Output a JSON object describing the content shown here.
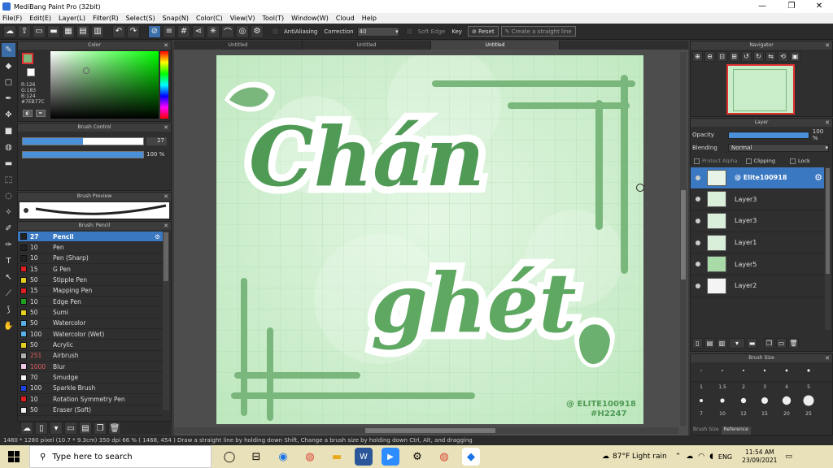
{
  "window": {
    "title": "MediBang Paint Pro (32bit)",
    "minimize": "—",
    "maximize": "❐",
    "close": "✕"
  },
  "menu": [
    "File(F)",
    "Edit(E)",
    "Layer(L)",
    "Filter(R)",
    "Select(S)",
    "Snap(N)",
    "Color(C)",
    "View(V)",
    "Tool(T)",
    "Window(W)",
    "Cloud",
    "Help"
  ],
  "toolbar": {
    "antialiasing": "AntiAliasing",
    "correction_label": "Correction",
    "correction_value": "40",
    "soft_edge": "Soft Edge",
    "key_label": "Key",
    "reset": "Reset",
    "straight_line": "Create a straight line"
  },
  "tabs": [
    "Untitled",
    "Untitled",
    "Untitled"
  ],
  "color_panel": {
    "title": "Color",
    "r": "R:126",
    "g": "G:183",
    "b": "B:124",
    "hex": "#7EB77C",
    "primary_color": "#7EB77C"
  },
  "brush_control": {
    "title": "Brush Control",
    "size": "27",
    "opacity": "100 %",
    "size_fill": 0.5,
    "opacity_fill": 1.0
  },
  "brush_preview": {
    "title": "Brush Preview"
  },
  "brush_list": {
    "title": "Brush: Pencil",
    "items": [
      {
        "size": "27",
        "name": "Pencil",
        "color": "#222222"
      },
      {
        "size": "10",
        "name": "Pen",
        "color": "#222222"
      },
      {
        "size": "10",
        "name": "Pen (Sharp)",
        "color": "#222222"
      },
      {
        "size": "15",
        "name": "G Pen",
        "color": "#e02020"
      },
      {
        "size": "50",
        "name": "Stipple Pen",
        "color": "#e8d020"
      },
      {
        "size": "15",
        "name": "Mapping Pen",
        "color": "#e02020"
      },
      {
        "size": "10",
        "name": "Edge Pen",
        "color": "#20a020"
      },
      {
        "size": "50",
        "name": "Sumi",
        "color": "#e8d020"
      },
      {
        "size": "50",
        "name": "Watercolor",
        "color": "#5ab0e8"
      },
      {
        "size": "100",
        "name": "Watercolor (Wet)",
        "color": "#5ab0e8"
      },
      {
        "size": "50",
        "name": "Acrylic",
        "color": "#e8d020"
      },
      {
        "size": "251",
        "name": "Airbrush",
        "color": "#b0b0b0"
      },
      {
        "size": "1000",
        "name": "Blur",
        "color": "#f0c8e8"
      },
      {
        "size": "70",
        "name": "Smudge",
        "color": "#f0f0f0"
      },
      {
        "size": "100",
        "name": "Sparkle Brush",
        "color": "#2040e0"
      },
      {
        "size": "10",
        "name": "Rotation Symmetry Pen",
        "color": "#e02020"
      },
      {
        "size": "50",
        "name": "Eraser (Soft)",
        "color": "#f0f0f0"
      }
    ]
  },
  "artwork": {
    "word1": "Chán",
    "word2": "ghét",
    "signature": "@ ELITE100918",
    "hashtag": "#H2247",
    "colors": {
      "bg": "#bfe8bf",
      "dark_green": "#4f9a55",
      "mid_green": "#7ab77c",
      "outline": "#ffffff"
    }
  },
  "navigator": {
    "title": "Navigator"
  },
  "layer_panel": {
    "title": "Layer",
    "opacity_label": "Opacity",
    "opacity_value": "100 %",
    "blending_label": "Blending",
    "blending_value": "Normal",
    "protect_alpha": "Protect Alpha",
    "clipping": "Clipping",
    "lock": "Lock",
    "layers": [
      "@ Elite100918",
      "Layer3",
      "Layer3",
      "Layer1",
      "Layer5",
      "Layer2"
    ]
  },
  "brush_size": {
    "title": "Brush Size",
    "labels": [
      "1",
      "1.5",
      "2",
      "3",
      "4",
      "5",
      "7",
      "10",
      "12",
      "15",
      "20",
      "25"
    ],
    "tab1": "Brush Size",
    "tab2": "Reference"
  },
  "status": "1480 * 1280 pixel  (10.7 * 9.3cm)  350 dpi  66 %  ( 1468, 454 )  Draw a straight line by holding down Shift, Change a brush size by holding down Ctrl, Alt, and dragging",
  "taskbar": {
    "search_placeholder": "Type here to search",
    "weather": "87°F  Light rain",
    "lang": "ENG",
    "time": "11:54 AM",
    "date": "23/09/2021"
  }
}
